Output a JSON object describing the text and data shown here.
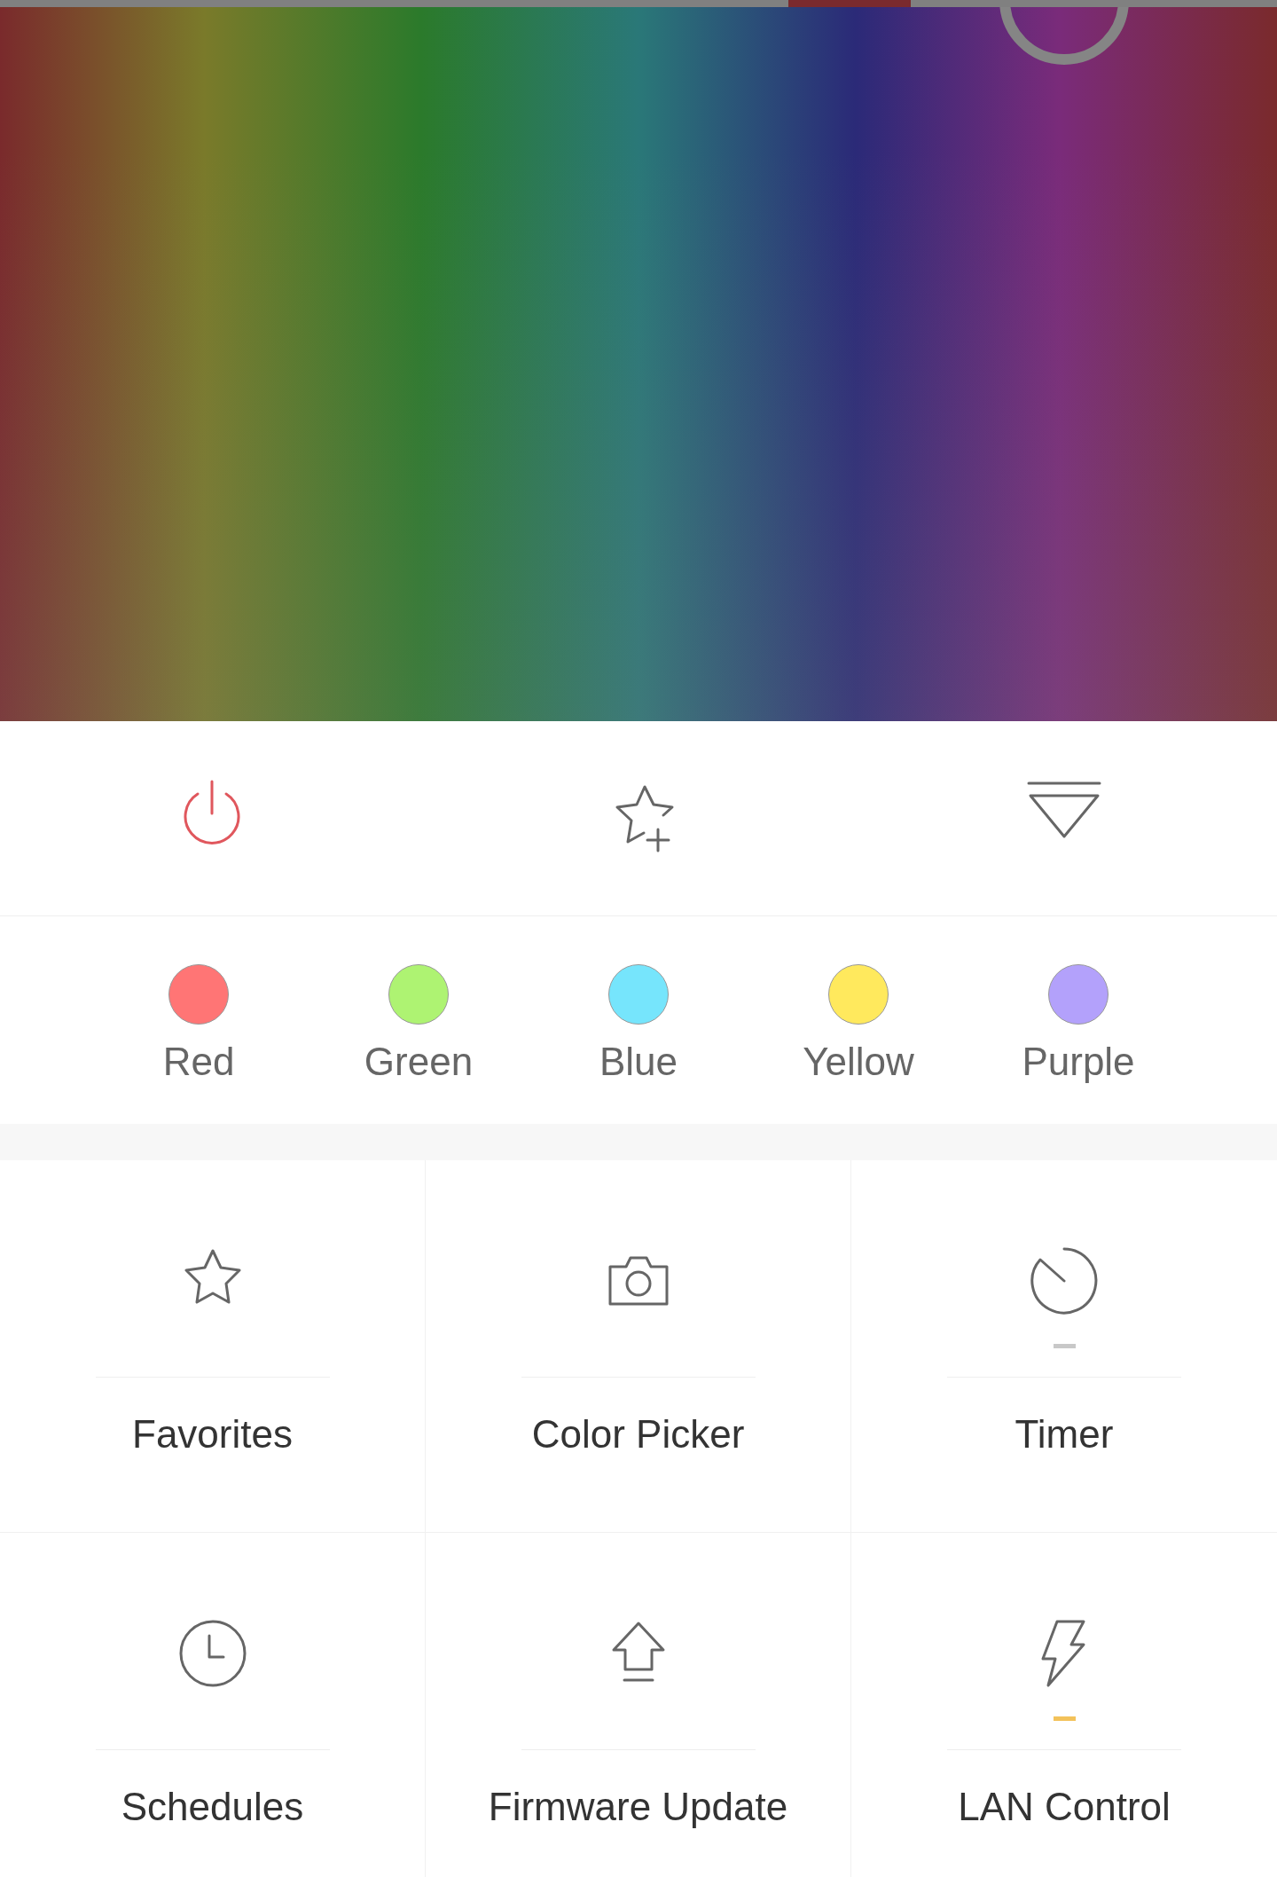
{
  "hue_bar": {
    "level": 0.665
  },
  "controls": [
    {
      "kind": "power",
      "on": true
    },
    {
      "kind": "add-favorite"
    },
    {
      "kind": "dropdown"
    }
  ],
  "presets": [
    {
      "label": "Red",
      "color": "#ff7575"
    },
    {
      "label": "Green",
      "color": "#aef372"
    },
    {
      "label": "Blue",
      "color": "#76e5fc"
    },
    {
      "label": "Yellow",
      "color": "#ffe95d"
    },
    {
      "label": "Purple",
      "color": "#b3a1fb"
    }
  ],
  "features": [
    {
      "kind": "star",
      "label": "Favorites"
    },
    {
      "kind": "camera",
      "label": "Color Picker"
    },
    {
      "kind": "timer",
      "label": "Timer",
      "active": false
    },
    {
      "kind": "clock",
      "label": "Schedules"
    },
    {
      "kind": "upload",
      "label": "Firmware Update"
    },
    {
      "kind": "bolt",
      "label": "LAN Control",
      "active": true
    }
  ]
}
